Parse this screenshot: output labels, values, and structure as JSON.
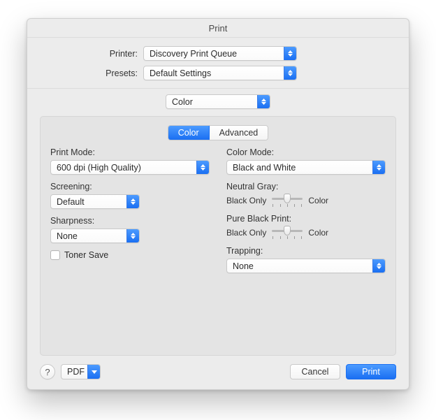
{
  "window": {
    "title": "Print"
  },
  "top": {
    "printer_label": "Printer:",
    "printer_value": "Discovery Print Queue",
    "presets_label": "Presets:",
    "presets_value": "Default Settings",
    "section_value": "Color"
  },
  "tabs": {
    "color": "Color",
    "advanced": "Advanced"
  },
  "left": {
    "print_mode_label": "Print Mode:",
    "print_mode_value": "600 dpi (High Quality)",
    "screening_label": "Screening:",
    "screening_value": "Default",
    "sharpness_label": "Sharpness:",
    "sharpness_value": "None",
    "toner_save_label": "Toner Save"
  },
  "right": {
    "color_mode_label": "Color Mode:",
    "color_mode_value": "Black and White",
    "neutral_gray_label": "Neutral Gray:",
    "pure_black_label": "Pure Black Print:",
    "slider_left": "Black Only",
    "slider_right": "Color",
    "trapping_label": "Trapping:",
    "trapping_value": "None"
  },
  "footer": {
    "help": "?",
    "pdf": "PDF",
    "cancel": "Cancel",
    "print": "Print"
  }
}
